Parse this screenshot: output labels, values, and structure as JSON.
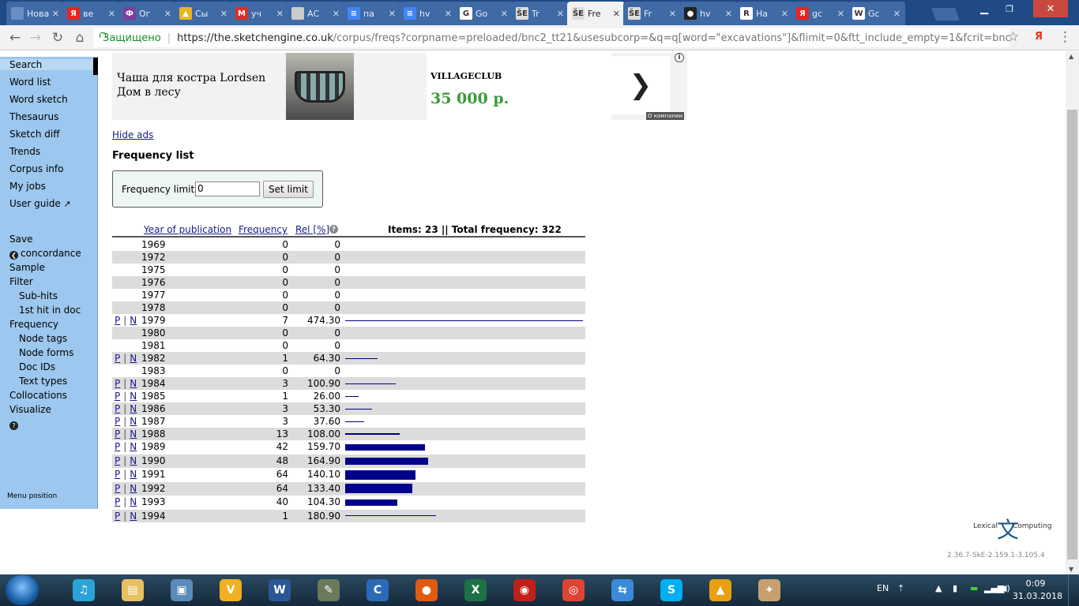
{
  "browser": {
    "tabs": [
      {
        "label": "Новая",
        "fav": "new-tab-icon",
        "color": "#6a8fc4",
        "glyph": ""
      },
      {
        "label": "ве",
        "fav": "yandex-icon",
        "color": "#e52620",
        "glyph": "Я"
      },
      {
        "label": "Ог",
        "fav": "site-icon",
        "color": "#7b3f9e",
        "glyph": "Ф"
      },
      {
        "label": "Сы",
        "fav": "folder-icon",
        "color": "#e8b620",
        "glyph": "▲"
      },
      {
        "label": "уч",
        "fav": "gmail-icon",
        "color": "#d93025",
        "glyph": "M"
      },
      {
        "label": "АС",
        "fav": "document-icon",
        "color": "#cccccc",
        "glyph": ""
      },
      {
        "label": "па",
        "fav": "google-docs-icon",
        "color": "#4285f4",
        "glyph": "≡"
      },
      {
        "label": "hv",
        "fav": "google-docs-icon",
        "color": "#4285f4",
        "glyph": "≡"
      },
      {
        "label": "Go",
        "fav": "google-icon",
        "color": "#ffffff",
        "glyph": "G"
      },
      {
        "label": "Tr",
        "fav": "sketchengine-icon",
        "color": "#dddddd",
        "glyph": "ŠE"
      },
      {
        "label": "Fre",
        "fav": "sketchengine-icon",
        "color": "#dddddd",
        "glyph": "ŠE"
      },
      {
        "label": "Fr",
        "fav": "sketchengine-icon",
        "color": "#dddddd",
        "glyph": "ŠE"
      },
      {
        "label": "hv",
        "fav": "github-icon",
        "color": "#222222",
        "glyph": "●"
      },
      {
        "label": "На",
        "fav": "site-icon",
        "color": "#ffffff",
        "glyph": "R"
      },
      {
        "label": "gc",
        "fav": "yandex-icon",
        "color": "#e52620",
        "glyph": "Я"
      },
      {
        "label": "Gc",
        "fav": "wikipedia-icon",
        "color": "#ffffff",
        "glyph": "W"
      }
    ],
    "active_tab_index": 10,
    "secure_label": "Защищено",
    "url_host": "https://the.sketchengine.co.uk",
    "url_path": "/corpus/freqs?corpname=preloaded/bnc2_tt21&usesubcorp=&q=q[word=\"excavations\"]&flimit=0&ftt_include_empty=1&fcrit=bncdo…",
    "yandex_ext": "Я"
  },
  "sidebar": {
    "items": [
      {
        "label": "Search",
        "type": "main",
        "active": true
      },
      {
        "label": "Word list",
        "type": "main"
      },
      {
        "label": "Word sketch",
        "type": "main"
      },
      {
        "label": "Thesaurus",
        "type": "main"
      },
      {
        "label": "Sketch diff",
        "type": "main"
      },
      {
        "label": "Trends",
        "type": "main"
      },
      {
        "label": "Corpus info",
        "type": "main"
      },
      {
        "label": "My jobs",
        "type": "main"
      },
      {
        "label": "User guide",
        "type": "main",
        "icon": "external-link-icon",
        "icon_glyph": "↗"
      }
    ],
    "actions": [
      {
        "label": "Save",
        "type": "main"
      },
      {
        "label": "concordance",
        "type": "main",
        "icon": "back-circle-icon",
        "icon_glyph": "❮"
      },
      {
        "label": "Sample",
        "type": "main"
      },
      {
        "label": "Filter",
        "type": "main"
      },
      {
        "label": "Sub-hits",
        "type": "sub"
      },
      {
        "label": "1st hit in doc",
        "type": "sub"
      },
      {
        "label": "Frequency",
        "type": "main"
      },
      {
        "label": "Node tags",
        "type": "sub"
      },
      {
        "label": "Node forms",
        "type": "sub"
      },
      {
        "label": "Doc IDs",
        "type": "sub"
      },
      {
        "label": "Text types",
        "type": "sub"
      },
      {
        "label": "Collocations",
        "type": "main"
      },
      {
        "label": "Visualize",
        "type": "main"
      },
      {
        "label": "",
        "type": "main",
        "icon": "help-icon",
        "icon_glyph": "?"
      }
    ],
    "menu_position": "Menu position"
  },
  "ad": {
    "title": "Чаша для костра Lordsen Дом в лесу",
    "brand": "VILLAGECLUB",
    "price": "35 000 р.",
    "company_label": "О компании",
    "info_glyph": "i",
    "arrow_glyph": "❯"
  },
  "hide_ads": "Hide ads",
  "frequency_list": {
    "title": "Frequency list",
    "limit_label": "Frequency limit:",
    "limit_value": "0",
    "set_limit": "Set limit",
    "headers": {
      "year": "Year of publication",
      "frequency": "Frequency",
      "rel": "Rel [%]"
    },
    "summary": "Items: 23 || Total frequency: 322",
    "p_label": "P",
    "n_label": "N",
    "rows": [
      {
        "year": "1969",
        "freq": "0",
        "rel": "0"
      },
      {
        "year": "1972",
        "freq": "0",
        "rel": "0"
      },
      {
        "year": "1975",
        "freq": "0",
        "rel": "0"
      },
      {
        "year": "1976",
        "freq": "0",
        "rel": "0"
      },
      {
        "year": "1977",
        "freq": "0",
        "rel": "0"
      },
      {
        "year": "1978",
        "freq": "0",
        "rel": "0"
      },
      {
        "year": "1979",
        "freq": "7",
        "rel": "474.30"
      },
      {
        "year": "1980",
        "freq": "0",
        "rel": "0"
      },
      {
        "year": "1981",
        "freq": "0",
        "rel": "0"
      },
      {
        "year": "1982",
        "freq": "1",
        "rel": "64.30"
      },
      {
        "year": "1983",
        "freq": "0",
        "rel": "0"
      },
      {
        "year": "1984",
        "freq": "3",
        "rel": "100.90"
      },
      {
        "year": "1985",
        "freq": "1",
        "rel": "26.00"
      },
      {
        "year": "1986",
        "freq": "3",
        "rel": "53.30"
      },
      {
        "year": "1987",
        "freq": "3",
        "rel": "37.60"
      },
      {
        "year": "1988",
        "freq": "13",
        "rel": "108.00"
      },
      {
        "year": "1989",
        "freq": "42",
        "rel": "159.70"
      },
      {
        "year": "1990",
        "freq": "48",
        "rel": "164.90"
      },
      {
        "year": "1991",
        "freq": "64",
        "rel": "140.10"
      },
      {
        "year": "1992",
        "freq": "64",
        "rel": "133.40"
      },
      {
        "year": "1993",
        "freq": "40",
        "rel": "104.30"
      },
      {
        "year": "1994",
        "freq": "1",
        "rel": "180.90"
      }
    ],
    "bar_color": "#00008b"
  },
  "footer": {
    "left_word": "Lexical",
    "glyph": "文",
    "right_word": "Computing",
    "version": "2.36.7-SkE-2.159.1-3.105.4"
  },
  "taskbar": {
    "apps": [
      {
        "name": "music-player-icon",
        "color": "#2aa3d8",
        "glyph": "♫"
      },
      {
        "name": "file-explorer-icon",
        "color": "#e8c060",
        "glyph": "▤"
      },
      {
        "name": "photo-viewer-icon",
        "color": "#5a8ab8",
        "glyph": "▣"
      },
      {
        "name": "viber-icon",
        "color": "#f0b020",
        "glyph": "V"
      },
      {
        "name": "word-icon",
        "color": "#2b5797",
        "glyph": "W"
      },
      {
        "name": "image-editor-icon",
        "color": "#6a7a5a",
        "glyph": "✎"
      },
      {
        "name": "sync-app-icon",
        "color": "#2a6ab8",
        "glyph": "C"
      },
      {
        "name": "media-player-icon",
        "color": "#e05a10",
        "glyph": "●"
      },
      {
        "name": "excel-icon",
        "color": "#1e7145",
        "glyph": "X"
      },
      {
        "name": "recorder-icon",
        "color": "#c0201a",
        "glyph": "◉"
      },
      {
        "name": "chrome-icon",
        "color": "#dd4433",
        "glyph": "◎"
      },
      {
        "name": "phone-transfer-icon",
        "color": "#3a8ad8",
        "glyph": "⇆"
      },
      {
        "name": "skype-icon",
        "color": "#00aff0",
        "glyph": "S"
      },
      {
        "name": "triangle-app-icon",
        "color": "#e8a010",
        "glyph": "▲"
      },
      {
        "name": "paint-icon",
        "color": "#c8a070",
        "glyph": "✦"
      }
    ],
    "lang": "EN",
    "time": "0:09",
    "date": "31.03.2018"
  }
}
